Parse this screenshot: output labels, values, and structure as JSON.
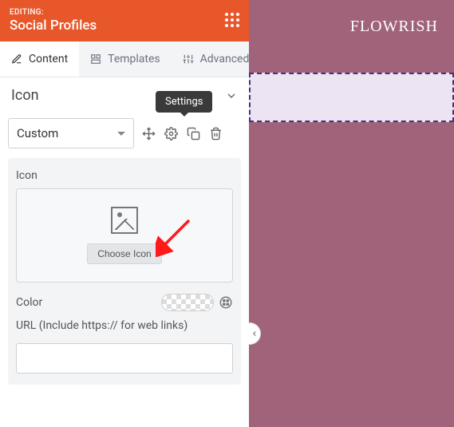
{
  "header": {
    "editing_label": "EDITING:",
    "title": "Social Profiles"
  },
  "tabs": {
    "items": [
      {
        "label": "Content"
      },
      {
        "label": "Templates"
      },
      {
        "label": "Advanced"
      }
    ]
  },
  "section": {
    "title": "Icon"
  },
  "iconType": {
    "selected": "Custom",
    "tooltip": "Settings"
  },
  "iconPicker": {
    "field_label": "Icon",
    "choose_label": "Choose Icon"
  },
  "color": {
    "label": "Color"
  },
  "url": {
    "label": "URL (Include https:// for web links)",
    "value": ""
  },
  "preview": {
    "brand": "FLOWRISH"
  }
}
